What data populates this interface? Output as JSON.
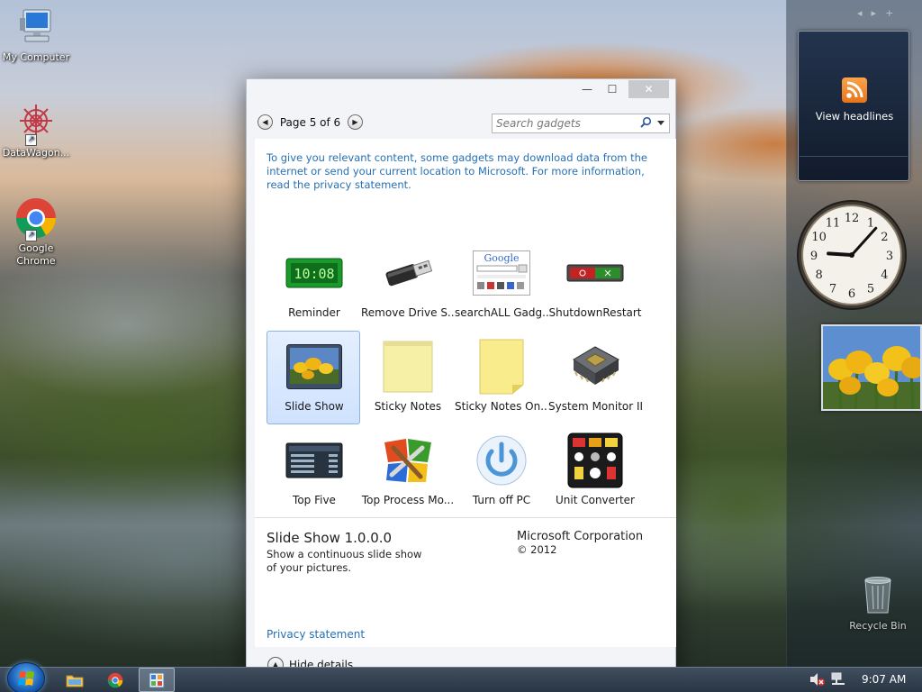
{
  "desktop": {
    "icons": [
      {
        "label": "My Computer",
        "icon": "computer-icon"
      },
      {
        "label": "DataWagon...",
        "icon": "datawagon-icon"
      },
      {
        "label": "Google Chrome",
        "icon": "chrome-icon"
      }
    ],
    "recycle_bin": {
      "label": "Recycle Bin",
      "icon": "recycle-bin-icon"
    }
  },
  "gadget_window": {
    "titlebar": {
      "minimize": "—",
      "maximize": "☐",
      "close": "✕"
    },
    "pager": {
      "label": "Page 5 of 6",
      "prev_icon": "◀",
      "next_icon": "▶"
    },
    "search": {
      "placeholder": "Search gadgets"
    },
    "info_text": "To give you relevant content, some gadgets may download data from the internet or send your current location to Microsoft. For more information, read the privacy statement.",
    "gadgets": [
      {
        "label": "Reminder",
        "icon": "reminder-icon",
        "selected": false
      },
      {
        "label": "Remove Drive S...",
        "icon": "usb-drive-icon",
        "selected": false
      },
      {
        "label": "searchALL Gadg...",
        "icon": "google-search-icon",
        "selected": false
      },
      {
        "label": "ShutdownRestart",
        "icon": "shutdown-restart-icon",
        "selected": false
      },
      {
        "label": "Slide Show",
        "icon": "slideshow-icon",
        "selected": true
      },
      {
        "label": "Sticky Notes",
        "icon": "sticky-note-icon",
        "selected": false
      },
      {
        "label": "Sticky Notes On...",
        "icon": "sticky-note-online-icon",
        "selected": false
      },
      {
        "label": "System Monitor II",
        "icon": "cpu-chip-icon",
        "selected": false
      },
      {
        "label": "Top Five",
        "icon": "top-five-icon",
        "selected": false
      },
      {
        "label": "Top Process Mo...",
        "icon": "process-tools-icon",
        "selected": false
      },
      {
        "label": "Turn off PC",
        "icon": "power-icon",
        "selected": false
      },
      {
        "label": "Unit Converter",
        "icon": "unit-converter-icon",
        "selected": false
      }
    ],
    "details": {
      "title": "Slide Show 1.0.0.0",
      "description": "Show a continuous slide show of your pictures.",
      "publisher": "Microsoft Corporation",
      "copyright": "© 2012",
      "privacy_link": "Privacy statement"
    },
    "footer": {
      "hide_details": "Hide details"
    }
  },
  "sidebar": {
    "nav": {
      "prev": "◂",
      "next": "▸",
      "add": "+"
    },
    "feed": {
      "label": "View headlines",
      "icon": "rss-icon"
    },
    "clock": {
      "hour": 9,
      "minute": 7
    }
  },
  "taskbar": {
    "items": [
      {
        "name": "windows-explorer-button",
        "icon": "folder-icon"
      },
      {
        "name": "chrome-taskbar-button",
        "icon": "chrome-icon"
      },
      {
        "name": "gadgets-taskbar-button",
        "icon": "gadgets-icon",
        "active": true
      }
    ],
    "tray": {
      "time": "9:07 AM",
      "icons": [
        "volume-muted-icon",
        "network-icon"
      ]
    }
  }
}
